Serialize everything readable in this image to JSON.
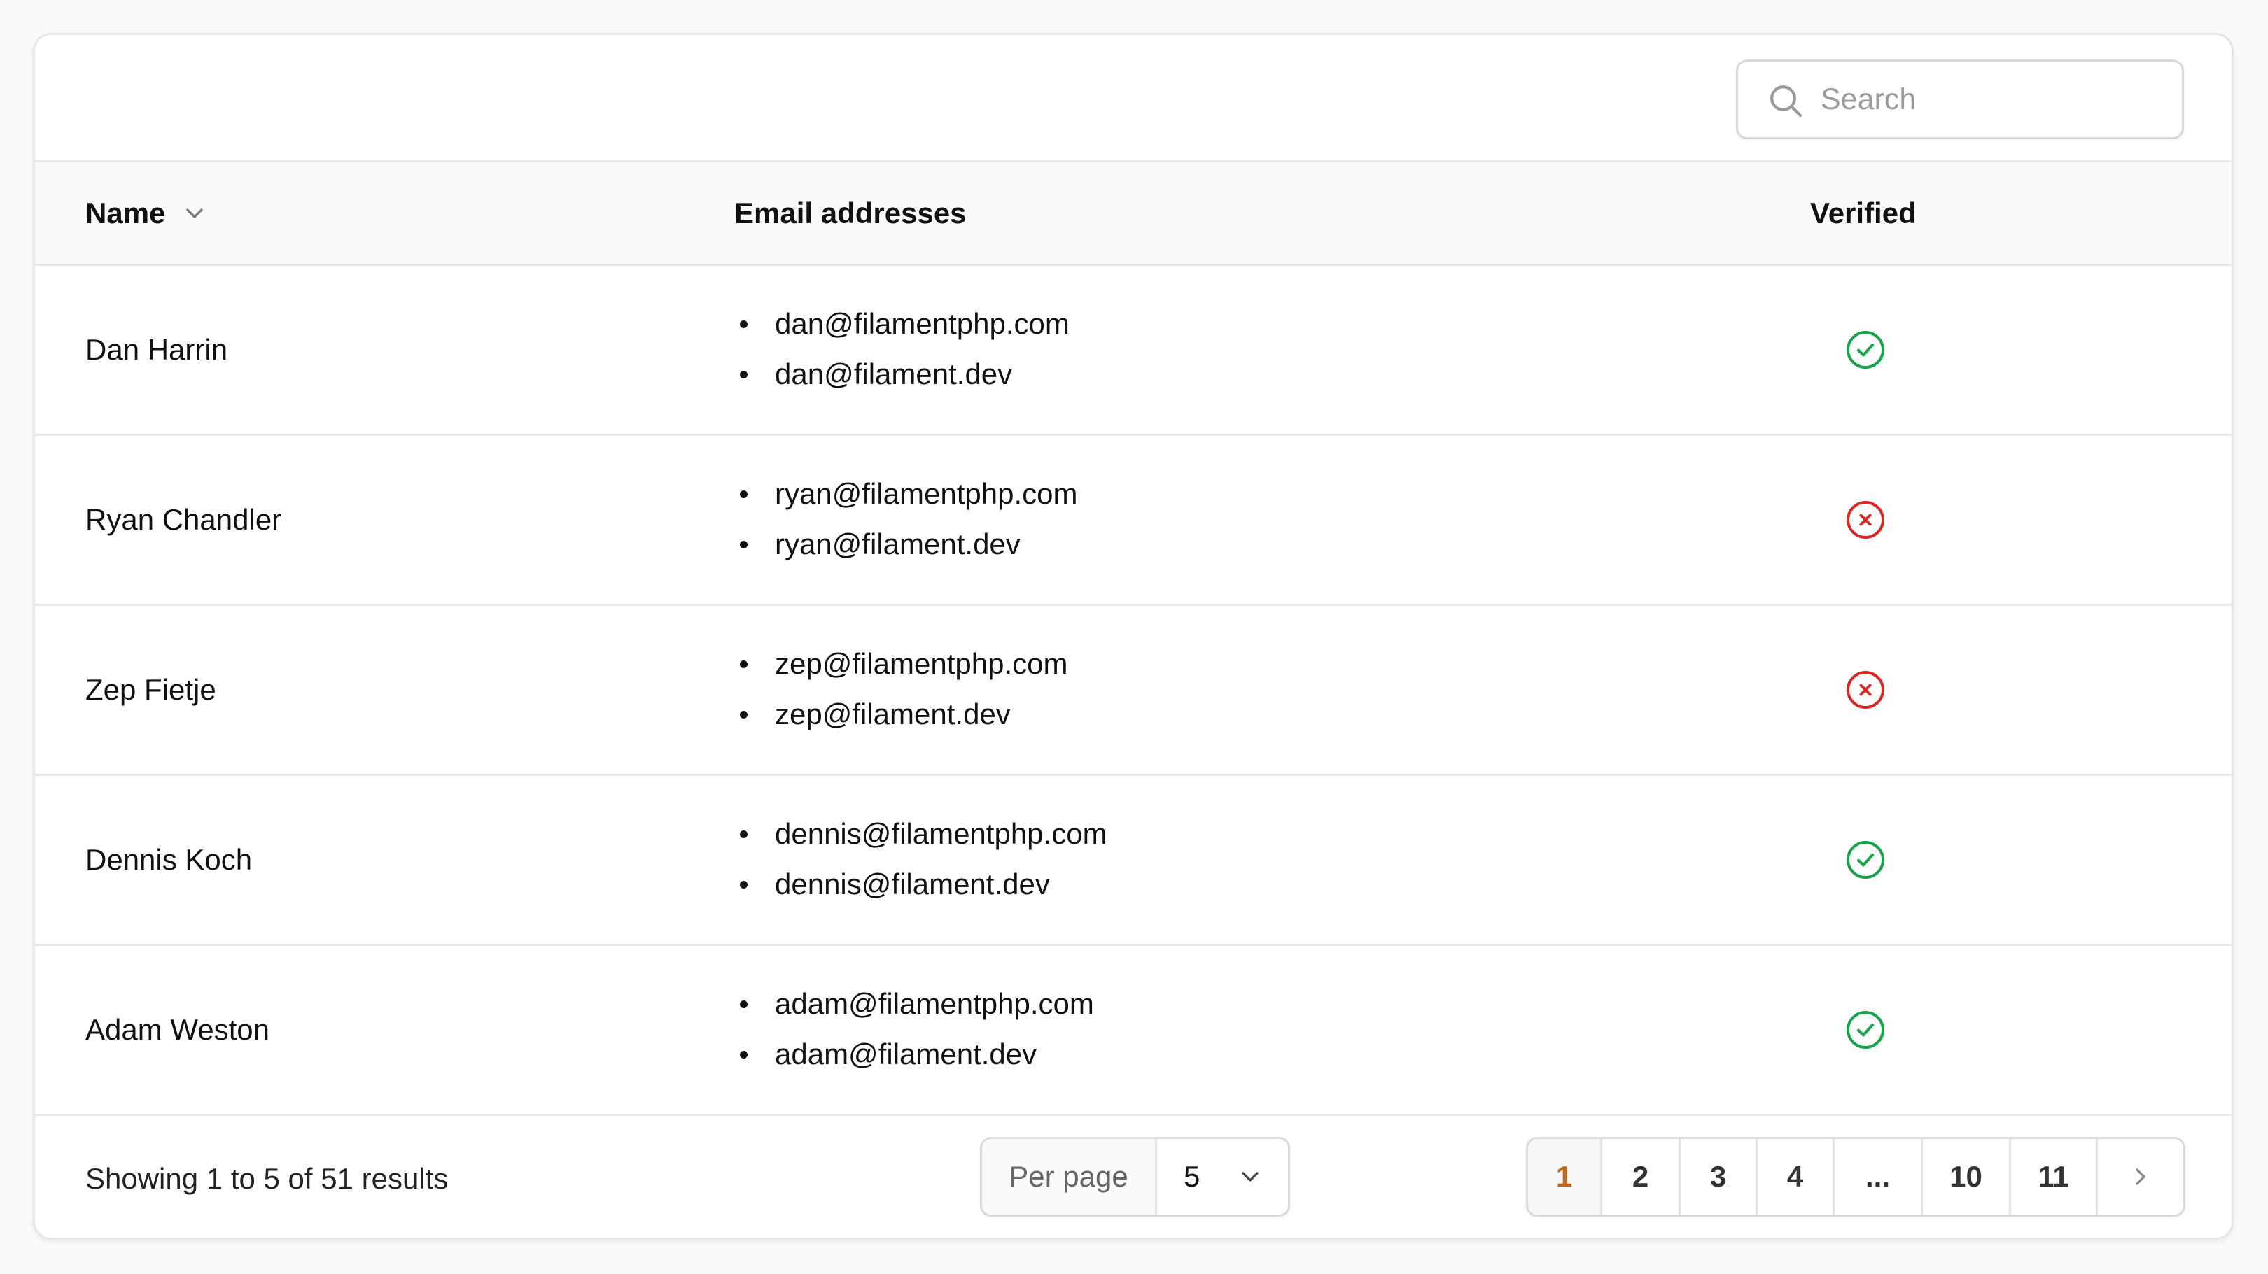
{
  "search": {
    "placeholder": "Search",
    "icon": "search-icon"
  },
  "table": {
    "columns": {
      "name": "Name",
      "emails": "Email addresses",
      "verified": "Verified"
    },
    "sort_icon": "chevron-down-icon",
    "rows": [
      {
        "name": "Dan Harrin",
        "emails": [
          "dan@filamentphp.com",
          "dan@filament.dev"
        ],
        "verified": true
      },
      {
        "name": "Ryan Chandler",
        "emails": [
          "ryan@filamentphp.com",
          "ryan@filament.dev"
        ],
        "verified": false
      },
      {
        "name": "Zep Fietje",
        "emails": [
          "zep@filamentphp.com",
          "zep@filament.dev"
        ],
        "verified": false
      },
      {
        "name": "Dennis Koch",
        "emails": [
          "dennis@filamentphp.com",
          "dennis@filament.dev"
        ],
        "verified": true
      },
      {
        "name": "Adam Weston",
        "emails": [
          "adam@filamentphp.com",
          "adam@filament.dev"
        ],
        "verified": true
      }
    ]
  },
  "footer": {
    "results_text": "Showing 1 to 5 of 51 results",
    "per_page_label": "Per page",
    "per_page_value": "5",
    "pages": [
      {
        "label": "1",
        "active": true
      },
      {
        "label": "2",
        "active": false
      },
      {
        "label": "3",
        "active": false
      },
      {
        "label": "4",
        "active": false
      },
      {
        "label": "...",
        "active": false
      },
      {
        "label": "10",
        "active": false
      },
      {
        "label": "11",
        "active": false
      }
    ],
    "next_icon": "chevron-right-icon"
  },
  "colors": {
    "verified_true": "#16a34a",
    "verified_false": "#dc2626",
    "active_page": "#c4691a",
    "border": "#e8e8e8"
  }
}
